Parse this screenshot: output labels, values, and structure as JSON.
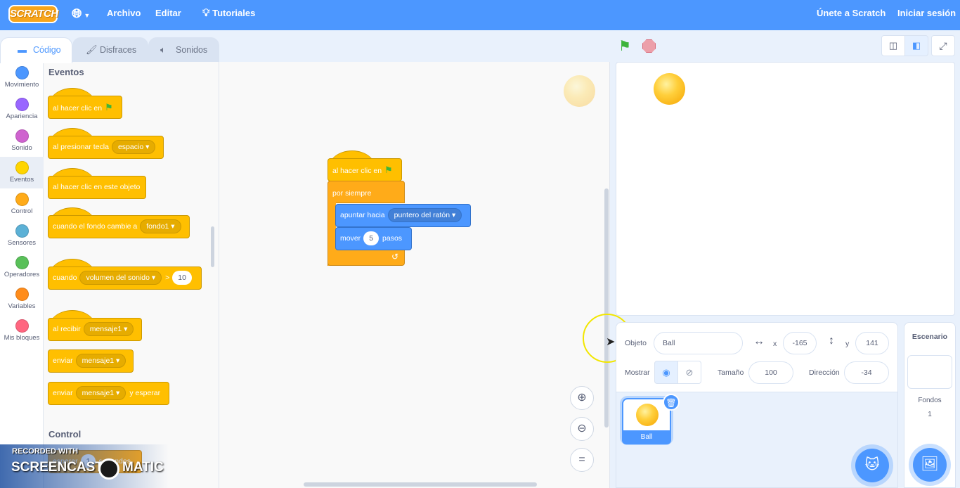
{
  "menubar": {
    "logo": "SCRATCH",
    "language_icon": "globe-icon",
    "file": "Archivo",
    "edit": "Editar",
    "tutorials": "Tutoriales",
    "join": "Únete a Scratch",
    "signin": "Iniciar sesión"
  },
  "tabs": [
    {
      "label": "Código",
      "icon": "code-icon"
    },
    {
      "label": "Disfraces",
      "icon": "brush-icon"
    },
    {
      "label": "Sonidos",
      "icon": "speaker-icon"
    }
  ],
  "categories": [
    {
      "label": "Movimiento",
      "color": "#4c97ff"
    },
    {
      "label": "Apariencia",
      "color": "#9966ff"
    },
    {
      "label": "Sonido",
      "color": "#cf63cf"
    },
    {
      "label": "Eventos",
      "color": "#ffd500"
    },
    {
      "label": "Control",
      "color": "#ffab19"
    },
    {
      "label": "Sensores",
      "color": "#5cb1d6"
    },
    {
      "label": "Operadores",
      "color": "#59c059"
    },
    {
      "label": "Variables",
      "color": "#ff8c1a"
    },
    {
      "label": "Mis bloques",
      "color": "#ff6680"
    }
  ],
  "palette": {
    "events_heading": "Eventos",
    "control_heading": "Control",
    "when_flag": "al hacer clic en",
    "when_key": "al presionar tecla",
    "key_value": "espacio",
    "when_sprite_clicked": "al hacer clic en este objeto",
    "when_backdrop": "cuando el fondo cambie a",
    "backdrop_value": "fondo1",
    "when_greater": "cuando",
    "greater_sensor": "volumen del sonido",
    "greater_op": ">",
    "greater_value": "10",
    "when_receive": "al recibir",
    "receive_value": "mensaje1",
    "broadcast": "enviar",
    "broadcast_value": "mensaje1",
    "broadcast_wait": "enviar",
    "broadcast_wait_value": "mensaje1",
    "broadcast_wait_suffix": "y esperar",
    "wait": "esperar",
    "wait_value": "1",
    "wait_suffix": "segundos"
  },
  "script": {
    "hat": "al hacer clic en",
    "forever": "por siempre",
    "point_towards": "apuntar hacia",
    "point_target": "puntero del ratón",
    "move": "mover",
    "move_steps": "5",
    "move_suffix": "pasos",
    "loop_arrow": "↺"
  },
  "sprite_info": {
    "sprite_label": "Objeto",
    "sprite_name": "Ball",
    "x_label": "x",
    "x_value": "-165",
    "y_label": "y",
    "y_value": "141",
    "show_label": "Mostrar",
    "size_label": "Tamaño",
    "size_value": "100",
    "direction_label": "Dirección",
    "direction_value": "-34"
  },
  "sprites": [
    {
      "name": "Ball"
    }
  ],
  "stage_panel": {
    "title": "Escenario",
    "backdrops_label": "Fondos",
    "backdrops_count": "1"
  },
  "watermark": {
    "line1": "RECORDED WITH",
    "line2a": "SCREENCAST",
    "line2b": "MATIC"
  }
}
